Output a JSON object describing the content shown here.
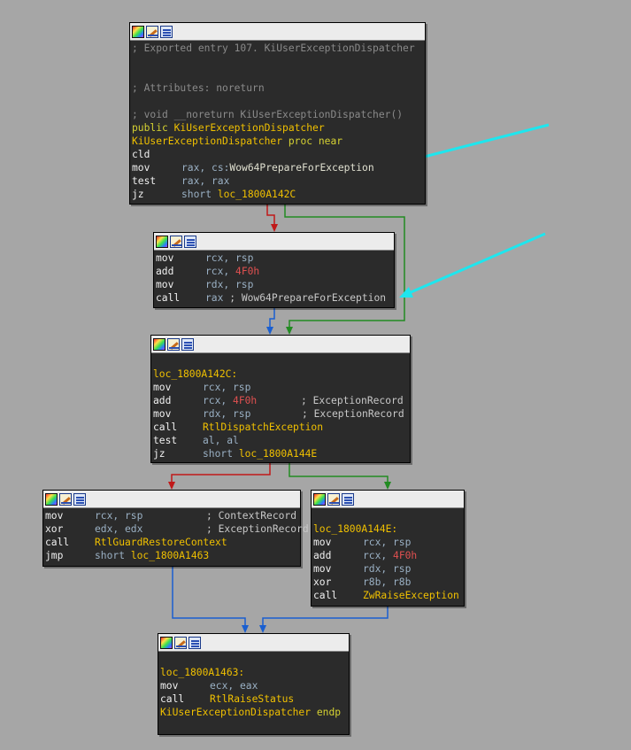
{
  "colors": {
    "background": "#a6a6a6",
    "node_bg": "#2b2b2b",
    "edge_true": "#228b22",
    "edge_false": "#c01818",
    "edge_jump": "#1a5fd0",
    "annotation_arrow": "#1ee6ee",
    "label": "#f0c000",
    "keyword": "#d6d232",
    "register": "#9ab0c4",
    "immediate": "#e05050",
    "comment": "#8a8a8a"
  },
  "header_icons": [
    "color-palette-icon",
    "rename-icon",
    "group-nodes-icon"
  ],
  "nodes": {
    "entry": {
      "lines": [
        [
          "; Exported entry 107. KiUserExceptionDispatcher"
        ],
        [
          ""
        ],
        [
          ""
        ],
        [
          "; Attributes: noreturn"
        ],
        [
          ""
        ],
        [
          "; void __noreturn KiUserExceptionDispatcher()"
        ],
        [
          "public ",
          "KiUserExceptionDispatcher"
        ],
        [
          "KiUserExceptionDispatcher",
          " proc near"
        ],
        [
          "cld"
        ],
        [
          "mov",
          "rax, ",
          "cs:",
          "Wow64PrepareForException"
        ],
        [
          "test",
          "rax, rax"
        ],
        [
          "jz",
          "short ",
          "loc_1800A142C"
        ]
      ]
    },
    "wow64": {
      "lines": [
        [
          "mov",
          "rcx, rsp"
        ],
        [
          "add",
          "rcx, ",
          "4F0h"
        ],
        [
          "mov",
          "rdx, rsp"
        ],
        [
          "call",
          "rax ",
          "; Wow64PrepareForException"
        ]
      ]
    },
    "dispatch": {
      "lines": [
        [
          ""
        ],
        [
          "loc_1800A142C:"
        ],
        [
          "mov",
          "rcx, rsp"
        ],
        [
          "add",
          "rcx, ",
          "4F0h",
          "; ExceptionRecord"
        ],
        [
          "mov",
          "rdx, rsp",
          "; ExceptionRecord"
        ],
        [
          "call",
          "RtlDispatchException"
        ],
        [
          "test",
          "al, al"
        ],
        [
          "jz",
          "short ",
          "loc_1800A144E"
        ]
      ]
    },
    "restore": {
      "lines": [
        [
          "mov",
          "rcx, rsp",
          "; ContextRecord"
        ],
        [
          "xor",
          "edx, edx",
          "; ExceptionRecord"
        ],
        [
          "call",
          "RtlGuardRestoreContext"
        ],
        [
          "jmp",
          "short ",
          "loc_1800A1463"
        ]
      ]
    },
    "raise": {
      "lines": [
        [
          ""
        ],
        [
          "loc_1800A144E:"
        ],
        [
          "mov",
          "rcx, rsp"
        ],
        [
          "add",
          "rcx, ",
          "4F0h"
        ],
        [
          "mov",
          "rdx, rsp"
        ],
        [
          "xor",
          "r8b, r8b"
        ],
        [
          "call",
          "ZwRaiseException"
        ]
      ]
    },
    "final": {
      "lines": [
        [
          ""
        ],
        [
          "loc_1800A1463:"
        ],
        [
          "mov",
          "ecx, eax"
        ],
        [
          "call",
          "RtlRaiseStatus"
        ],
        [
          "KiUserExceptionDispatcher",
          " endp"
        ]
      ]
    }
  }
}
